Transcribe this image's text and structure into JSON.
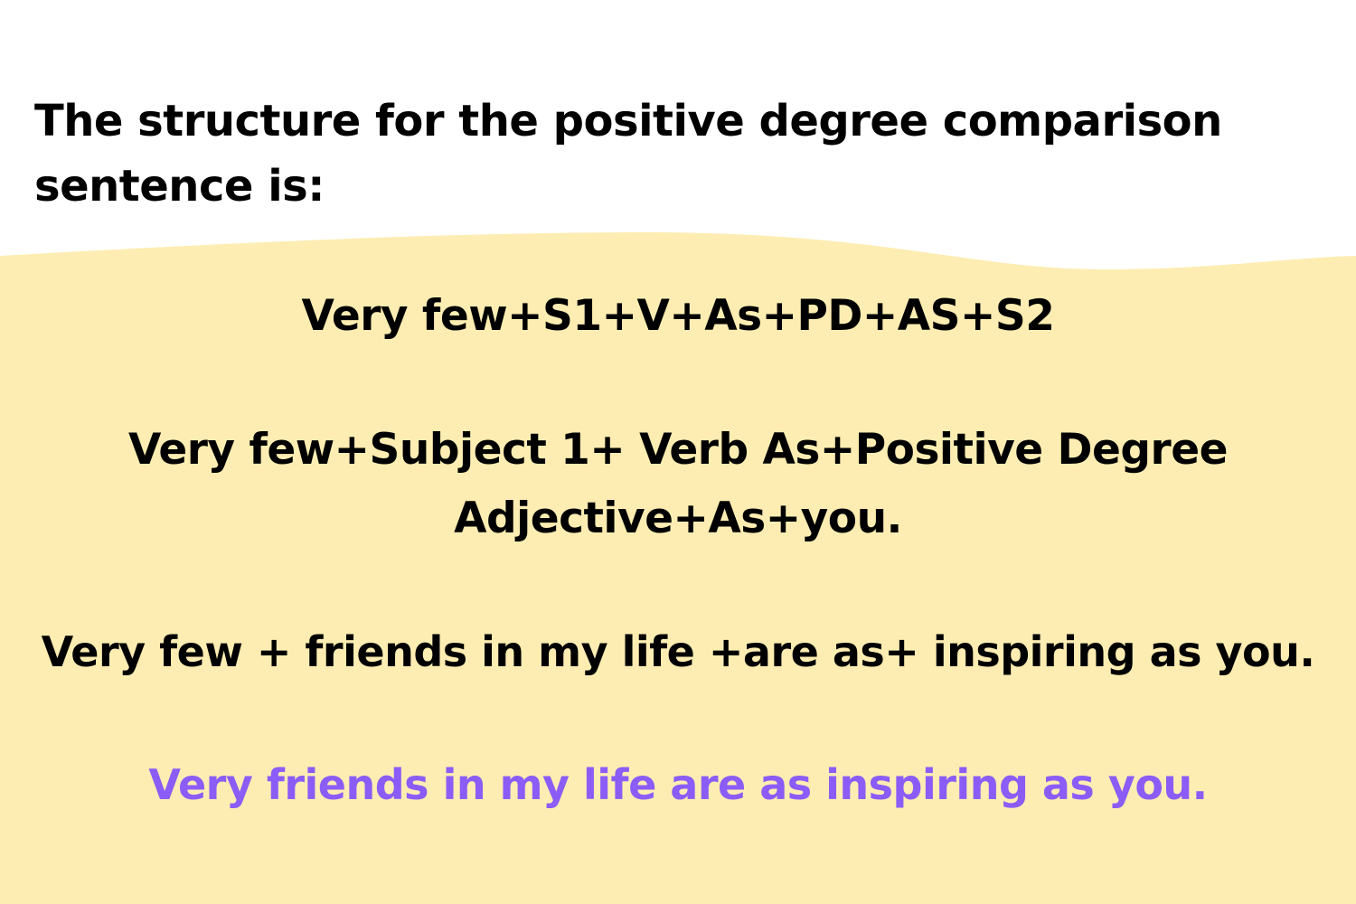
{
  "heading": "The structure for the positive degree comparison sentence is:",
  "formula_abbreviated": "Very few+S1+V+As+PD+AS+S2",
  "formula_full": "Very few+Subject 1+ Verb As+Positive Degree Adjective+As+you.",
  "example_broken_down": "Very few + friends in my life +are as+ inspiring as you.",
  "example_sentence": "Very friends in my life are as inspiring as you.",
  "colors": {
    "background_top": "#ffffff",
    "panel_background": "#fdedb2",
    "text_primary": "#000000",
    "text_highlight": "#8b5cf6"
  }
}
